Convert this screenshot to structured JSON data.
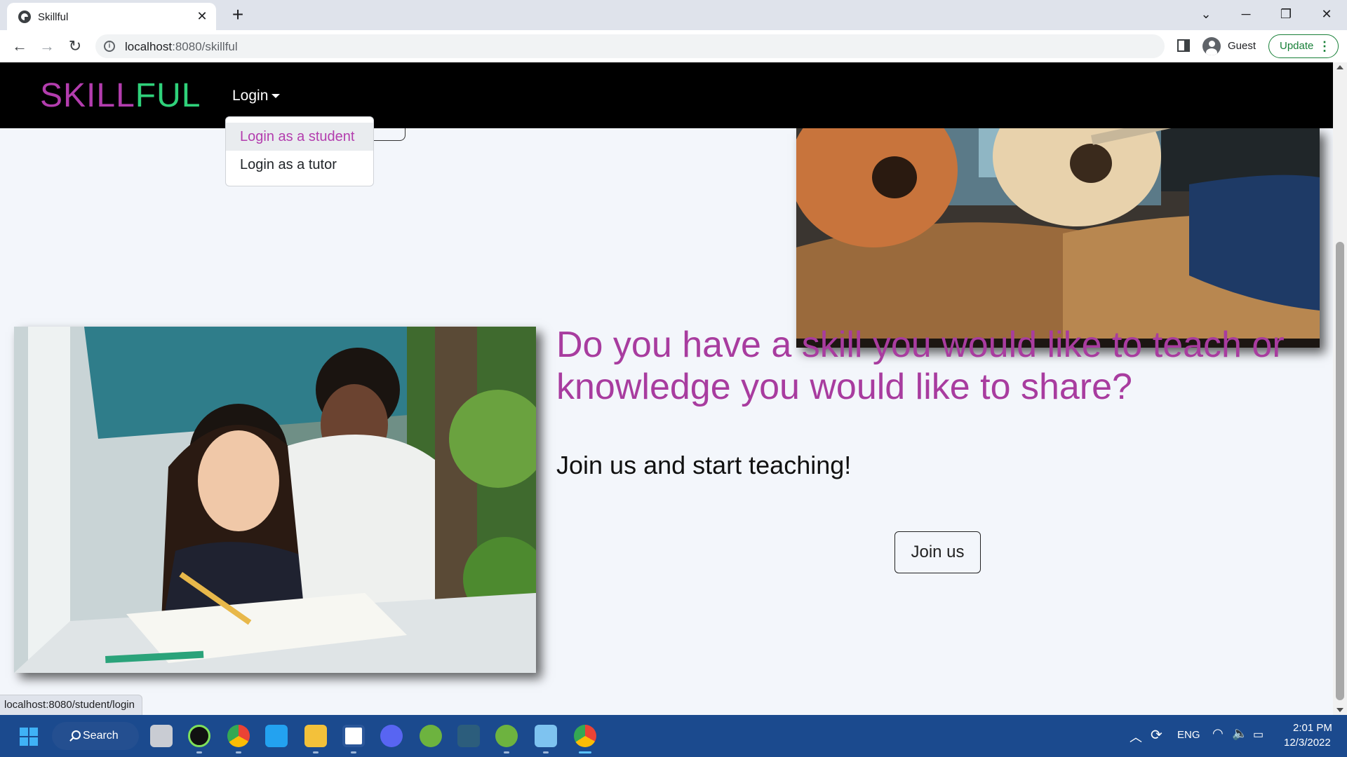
{
  "browser": {
    "tab_title": "Skillful",
    "url_host": "localhost",
    "url_rest": ":8080/skillful",
    "profile_label": "Guest",
    "update_label": "Update"
  },
  "navbar": {
    "brand_part1": "SKILL",
    "brand_part2": "FUL",
    "login_label": "Login"
  },
  "dropdown": {
    "items": [
      {
        "label": "Login as a student"
      },
      {
        "label": "Login as a tutor"
      }
    ]
  },
  "main": {
    "headline": "Do you have a skill you would like to teach or knowledge you would like to share?",
    "subheadline": "Join us and start teaching!",
    "join_button": "Join us"
  },
  "status_bar": {
    "link_url": "localhost:8080/student/login"
  },
  "taskbar": {
    "search_label": "Search",
    "language": "ENG",
    "time": "2:01 PM",
    "date": "12/3/2022"
  },
  "colors": {
    "brand_purple": "#b33dae",
    "brand_green": "#2fd17a",
    "headline_purple": "#a83c9f"
  }
}
